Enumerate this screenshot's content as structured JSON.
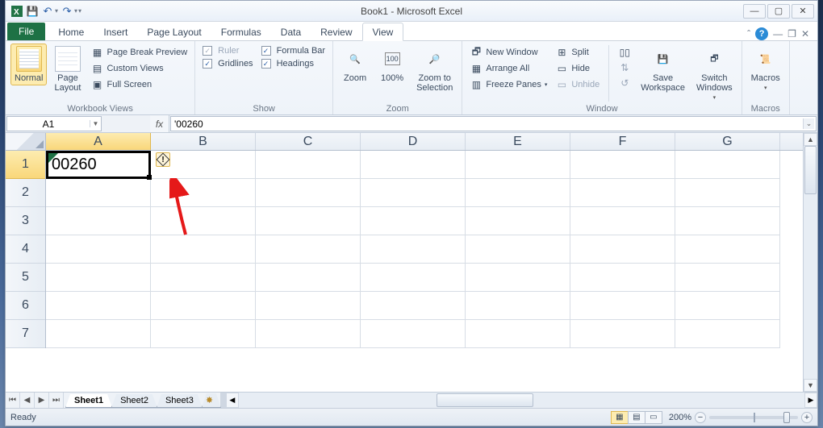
{
  "title": "Book1 - Microsoft Excel",
  "tabs": {
    "file": "File",
    "items": [
      "Home",
      "Insert",
      "Page Layout",
      "Formulas",
      "Data",
      "Review",
      "View"
    ],
    "active": "View"
  },
  "ribbon": {
    "workbook_views": {
      "label": "Workbook Views",
      "normal": "Normal",
      "page_layout": "Page\nLayout",
      "page_break": "Page Break Preview",
      "custom": "Custom Views",
      "full": "Full Screen"
    },
    "show": {
      "label": "Show",
      "ruler": "Ruler",
      "gridlines": "Gridlines",
      "formula_bar": "Formula Bar",
      "headings": "Headings"
    },
    "zoom_grp": {
      "label": "Zoom",
      "zoom": "Zoom",
      "hundred": "100%",
      "to_sel": "Zoom to\nSelection"
    },
    "window": {
      "label": "Window",
      "new": "New Window",
      "arrange": "Arrange All",
      "freeze": "Freeze Panes",
      "split": "Split",
      "hide": "Hide",
      "unhide": "Unhide",
      "save_ws": "Save\nWorkspace",
      "switch": "Switch\nWindows"
    },
    "macros": {
      "label": "Macros",
      "macros": "Macros"
    }
  },
  "namebox": "A1",
  "formula": "'00260",
  "columns": [
    "A",
    "B",
    "C",
    "D",
    "E",
    "F",
    "G"
  ],
  "rows": [
    "1",
    "2",
    "3",
    "4",
    "5",
    "6",
    "7"
  ],
  "cell_value": "00260",
  "sheets": {
    "active": "Sheet1",
    "others": [
      "Sheet2",
      "Sheet3"
    ]
  },
  "status": {
    "ready": "Ready",
    "zoom": "200%"
  }
}
